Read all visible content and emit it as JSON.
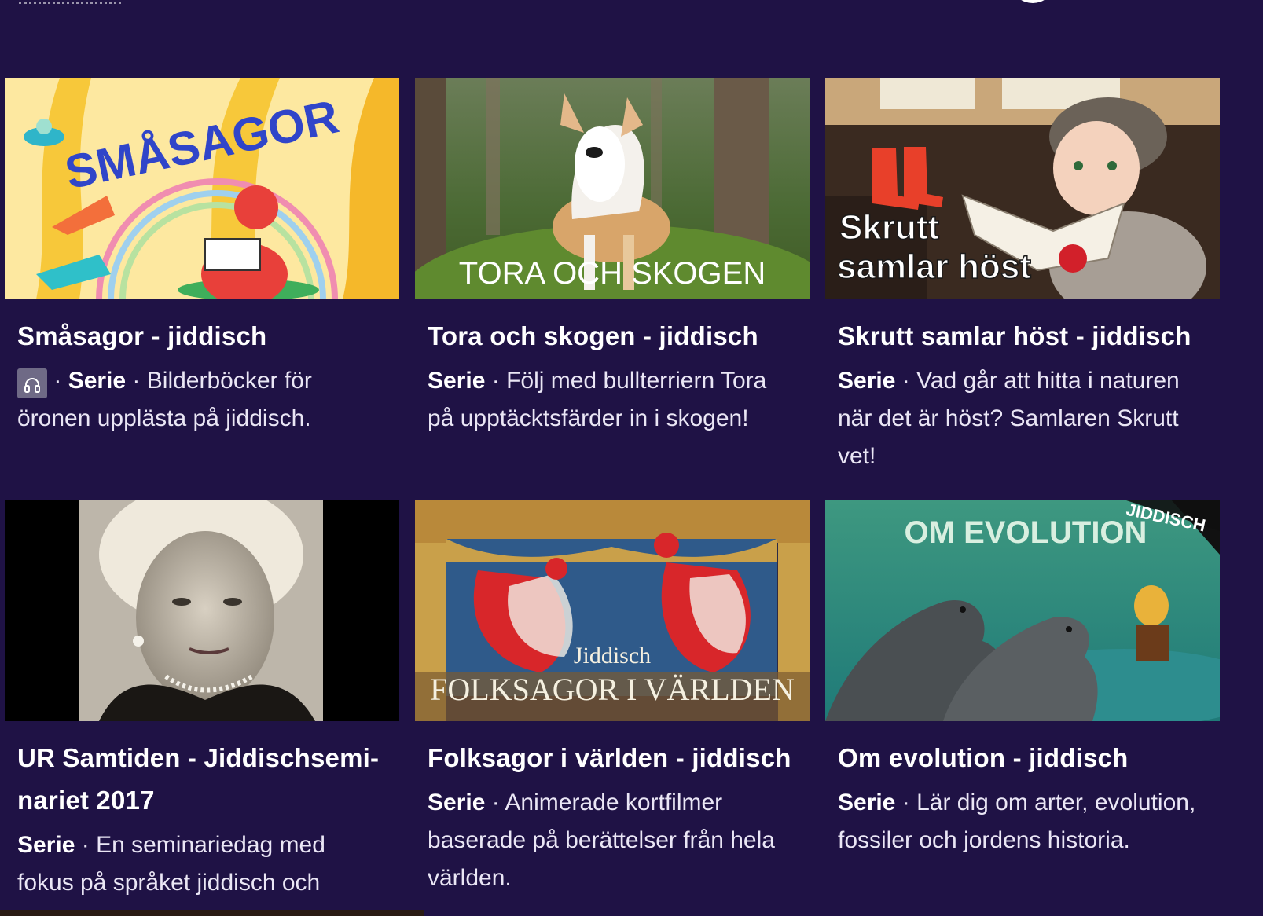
{
  "cards": [
    {
      "thumb_text": "SMÅSAGOR",
      "title": "Småsagor - jiddisch",
      "type": "Serie",
      "separator": "·",
      "description": "Bilderböcker för öronen upplästa på jiddisch.",
      "icon": "headphones-icon"
    },
    {
      "thumb_text": "TORA OCH SKOGEN",
      "title": "Tora och skogen - jiddisch",
      "type": "Serie",
      "separator": "·",
      "description": "Följ med bullterriern Tora på upptäcktsfärder in i skogen!"
    },
    {
      "thumb_text_1": "Skrutt",
      "thumb_text_2": "samlar höst",
      "title": "Skrutt samlar höst - jiddisch",
      "type": "Serie",
      "separator": "·",
      "description": "Vad går att hitta i naturen när det är höst? Samlaren Skrutt vet!"
    },
    {
      "title": "UR Samtiden - Jiddischsemi-nariet 2017",
      "type": "Serie",
      "separator": "·",
      "description": "En seminariedag med fokus på språket jiddisch och"
    },
    {
      "thumb_text_1": "Jiddisch",
      "thumb_text_2": "FOLKSAGOR I VÄRLDEN",
      "title": "Folksagor i världen - jiddisch",
      "type": "Serie",
      "separator": "·",
      "description": "Animerade kortfilmer baserade på berättelser från hela världen."
    },
    {
      "thumb_text_1": "OM EVOLUTION",
      "thumb_text_2": "JIDDISCH",
      "title": "Om evolution - jiddisch",
      "type": "Serie",
      "separator": "·",
      "description": "Lär dig om arter, evolution, fossiler och jordens historia."
    }
  ],
  "colors": {
    "background": "#1f1245",
    "text": "#ffffff",
    "badge": "#6f6a86"
  }
}
